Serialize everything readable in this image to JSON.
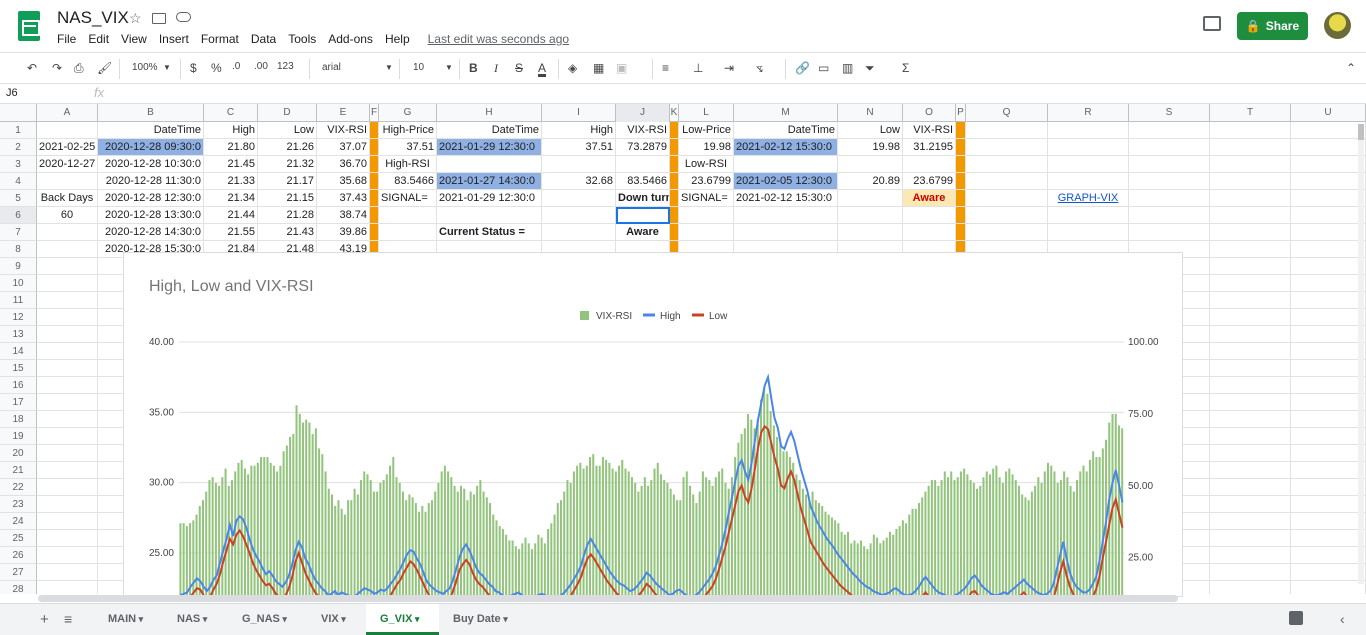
{
  "doc": {
    "title": "NAS_VIX",
    "last_edit": "Last edit was seconds ago",
    "share_label": "Share"
  },
  "menu": [
    "File",
    "Edit",
    "View",
    "Insert",
    "Format",
    "Data",
    "Tools",
    "Add-ons",
    "Help"
  ],
  "toolbar": {
    "zoom": "100%",
    "currency": "$",
    "percent": "%",
    "dec_less": ".0",
    "dec_more": ".00",
    "format_more": "123",
    "font": "arial",
    "font_size": "10",
    "bold": "B",
    "italic": "I",
    "strike": "S",
    "text_color": "A",
    "sigma": "Σ"
  },
  "formula": {
    "name_box": "J6",
    "fx": "fx",
    "value": ""
  },
  "columns": [
    "A",
    "B",
    "C",
    "D",
    "E",
    "F",
    "G",
    "H",
    "I",
    "J",
    "K",
    "L",
    "M",
    "N",
    "O",
    "P",
    "Q",
    "R",
    "S",
    "T",
    "U"
  ],
  "rows": [
    "1",
    "2",
    "3",
    "4",
    "5",
    "6",
    "7",
    "8",
    "9",
    "10",
    "11",
    "12",
    "13",
    "14",
    "15",
    "16",
    "17",
    "18",
    "19",
    "20",
    "21",
    "22",
    "23",
    "24",
    "25",
    "26",
    "27",
    "28"
  ],
  "cells": {
    "B1": "DateTime",
    "C1": "High",
    "D1": "Low",
    "E1": "VIX-RSI",
    "G1": "High-Price",
    "H1": "DateTime",
    "I1": "High",
    "J1": "VIX-RSI",
    "L1": "Low-Price",
    "M1": "DateTime",
    "N1": "Low",
    "O1": "VIX-RSI",
    "A2": "2021-02-25",
    "B2": "2020-12-28 09:30:0",
    "C2": "21.80",
    "D2": "21.26",
    "E2": "37.07",
    "G2": "37.51",
    "H2": "2021-01-29 12:30:0",
    "I2": "37.51",
    "J2": "73.2879",
    "L2": "19.98",
    "M2": "2021-02-12 15:30:0",
    "N2": "19.98",
    "O2": "31.2195",
    "A3": "2020-12-27",
    "B3": "2020-12-28 10:30:0",
    "C3": "21.45",
    "D3": "21.32",
    "E3": "36.70",
    "G3": "High-RSI",
    "L3": "Low-RSI",
    "B4": "2020-12-28 11:30:0",
    "C4": "21.33",
    "D4": "21.17",
    "E4": "35.68",
    "G4": "83.5466",
    "H4": "2021-01-27 14:30:0",
    "I4": "32.68",
    "J4": "83.5466",
    "L4": "23.6799",
    "M4": "2021-02-05 12:30:0",
    "N4": "20.89",
    "O4": "23.6799",
    "A5": "Back Days",
    "B5": "2020-12-28 12:30:0",
    "C5": "21.34",
    "D5": "21.15",
    "E5": "37.43",
    "G5": "SIGNAL=",
    "H5": "2021-01-29 12:30:0",
    "J5": "Down turn",
    "L5": "SIGNAL=",
    "M5": "2021-02-12 15:30:0",
    "O5": "Aware",
    "R5": "GRAPH-VIX",
    "A6": "60",
    "B6": "2020-12-28 13:30:0",
    "C6": "21.44",
    "D6": "21.28",
    "E6": "38.74",
    "B7": "2020-12-28 14:30:0",
    "C7": "21.55",
    "D7": "21.43",
    "E7": "39.86",
    "H7": "Current Status =",
    "J7": "Aware",
    "B8": "2020-12-28 15:30:0",
    "C8": "21.84",
    "D8": "21.48",
    "E8": "43.19",
    "B9": "202",
    "B10": "202",
    "B11": "202",
    "B12": "202",
    "B13": "202",
    "B14": "202",
    "B15": "202",
    "B16": "202",
    "B17": "202",
    "B18": "202",
    "B19": "202",
    "B20": "202",
    "B21": "202",
    "B22": "202",
    "B23": "202",
    "B24": "202",
    "B25": "202",
    "B26": "202",
    "B27": "202",
    "B28": "202"
  },
  "tabs": [
    "MAIN",
    "NAS",
    "G_NAS",
    "VIX",
    "G_VIX",
    "Buy Date"
  ],
  "active_tab": "G_VIX",
  "chart_data": {
    "type": "bar+line",
    "title": "High, Low and VIX-RSI",
    "legend": [
      "VIX-RSI",
      "High",
      "Low"
    ],
    "legend_position": "top",
    "colors": {
      "VIX-RSI": "#93c47d",
      "High": "#4a86e8",
      "Low": "#cc4125"
    },
    "y_left_ticks": [
      "40.00",
      "35.00",
      "30.00",
      "25.00"
    ],
    "y_right_ticks": [
      "100.00",
      "75.00",
      "50.00",
      "25.00"
    ],
    "y_left_range": [
      21.8,
      40
    ],
    "y_right_range": [
      11,
      100
    ],
    "vix_rsi": [
      37,
      37,
      36,
      37,
      38,
      40,
      43,
      45,
      48,
      52,
      53,
      51,
      50,
      53,
      56,
      50,
      52,
      55,
      58,
      59,
      56,
      54,
      57,
      57,
      58,
      60,
      60,
      60,
      58,
      57,
      55,
      57,
      62,
      64,
      67,
      68,
      78,
      75,
      72,
      73,
      72,
      68,
      70,
      63,
      61,
      55,
      49,
      47,
      43,
      45,
      42,
      40,
      45,
      45,
      49,
      47,
      52,
      55,
      54,
      52,
      48,
      48,
      51,
      52,
      54,
      57,
      60,
      53,
      51,
      48,
      45,
      47,
      46,
      44,
      41,
      43,
      41,
      44,
      45,
      48,
      51,
      55,
      57,
      55,
      53,
      50,
      48,
      50,
      49,
      45,
      48,
      47,
      50,
      52,
      48,
      46,
      44,
      40,
      38,
      36,
      35,
      33,
      31,
      31,
      29,
      28,
      30,
      32,
      30,
      28,
      30,
      33,
      32,
      30,
      35,
      37,
      40,
      44,
      45,
      48,
      52,
      51,
      55,
      57,
      58,
      56,
      57,
      60,
      61,
      57,
      57,
      60,
      59,
      58,
      56,
      55,
      57,
      59,
      56,
      55,
      53,
      51,
      48,
      50,
      53,
      50,
      52,
      56,
      58,
      54,
      52,
      51,
      49,
      47,
      45,
      45,
      53,
      55,
      50,
      47,
      44,
      48,
      55,
      53,
      52,
      50,
      53,
      55,
      56,
      51,
      49,
      53,
      60,
      65,
      68,
      70,
      75,
      73,
      70,
      73,
      80,
      84,
      82,
      76,
      71,
      67,
      65,
      62,
      62,
      60,
      58,
      54,
      52,
      49,
      47,
      45,
      48,
      45,
      44,
      43,
      41,
      40,
      39,
      38,
      37,
      34,
      33,
      34,
      30,
      31,
      30,
      31,
      29,
      28,
      30,
      33,
      32,
      30,
      31,
      32,
      34,
      33,
      35,
      36,
      38,
      37,
      40,
      42,
      42,
      44,
      46,
      48,
      50,
      52,
      52,
      50,
      52,
      55,
      53,
      55,
      52,
      53,
      55,
      56,
      54,
      52,
      51,
      49,
      50,
      53,
      55,
      54,
      56,
      57,
      53,
      51,
      55,
      56,
      54,
      52,
      50,
      47,
      46,
      45,
      48,
      50,
      53,
      51,
      55,
      58,
      57,
      55,
      51,
      52,
      55,
      53,
      50,
      48,
      52,
      55,
      57,
      55,
      59,
      62,
      60,
      60,
      63,
      66,
      72,
      75,
      75,
      71,
      70
    ],
    "high": [
      22.0,
      22.1,
      22.2,
      22.6,
      22.9,
      23.2,
      23.0,
      22.6,
      22.3,
      22.6,
      23.1,
      23.4,
      24.3,
      25.2,
      26.0,
      27.0,
      26.2,
      27.3,
      27.6,
      27.4,
      26.8,
      26.0,
      25.3,
      24.8,
      24.4,
      23.9,
      23.5,
      23.7,
      23.4,
      23.0,
      22.8,
      22.6,
      22.9,
      23.4,
      24.2,
      25.2,
      25.8,
      25.4,
      24.6,
      24.2,
      23.6,
      23.1,
      22.8,
      22.5,
      22.3,
      22.0,
      22.1,
      22.3,
      22.0,
      22.2,
      22.1,
      22.0,
      21.9,
      21.9,
      22.1,
      22.3,
      22.5,
      22.4,
      22.3,
      22.1,
      22.2,
      22.4,
      22.3,
      22.5,
      22.8,
      23.1,
      23.5,
      23.9,
      24.4,
      24.9,
      25.2,
      25.1,
      24.6,
      24.2,
      23.6,
      23.0,
      22.7,
      22.5,
      22.3,
      22.2,
      22.1,
      22.3,
      22.5,
      23.1,
      23.9,
      24.7,
      25.3,
      25.6,
      25.2,
      24.6,
      24.0,
      23.6,
      23.4,
      23.1,
      22.8,
      22.6,
      22.3,
      22.2,
      22.0,
      21.9,
      21.9,
      22.0,
      22.1,
      22.2,
      22.0,
      21.9,
      21.8,
      21.8,
      21.9,
      22.0,
      22.1,
      22.0,
      21.9,
      21.8,
      21.8,
      21.9,
      22.0,
      22.2,
      22.5,
      22.8,
      23.2,
      23.6,
      24.1,
      24.9,
      25.6,
      26.0,
      25.6,
      25.2,
      24.8,
      24.4,
      24.0,
      23.6,
      23.3,
      23.0,
      22.8,
      22.7,
      22.5,
      22.3,
      22.4,
      22.6,
      22.9,
      23.2,
      23.6,
      23.4,
      23.1,
      22.8,
      22.6,
      22.4,
      22.2,
      22.0,
      22.1,
      22.3,
      22.4,
      22.2,
      22.0,
      21.9,
      21.9,
      22.0,
      22.2,
      22.5,
      22.8,
      23.1,
      23.5,
      24.0,
      24.8,
      25.6,
      26.6,
      27.8,
      28.9,
      30.1,
      31.2,
      31.6,
      30.8,
      30.2,
      31.4,
      33.0,
      34.5,
      35.7,
      36.9,
      37.5,
      36.0,
      34.6,
      33.9,
      32.6,
      32.4,
      33.1,
      33.6,
      33.0,
      32.0,
      31.0,
      30.2,
      29.4,
      28.3,
      27.8,
      27.2,
      26.8,
      26.4,
      26.0,
      25.7,
      25.4,
      25.0,
      24.7,
      24.4,
      24.1,
      23.8,
      23.5,
      23.3,
      23.0,
      22.8,
      22.6,
      22.5,
      22.3,
      22.2,
      22.1,
      22.0,
      22.1,
      22.2,
      22.4,
      22.5,
      22.3,
      22.1,
      22.0,
      22.0,
      22.1,
      22.3,
      22.6,
      23.0,
      23.3,
      23.0,
      22.7,
      22.4,
      22.2,
      22.1,
      22.0,
      21.9,
      21.9,
      22.0,
      22.1,
      22.3,
      22.5,
      22.8,
      23.2,
      23.4,
      23.1,
      22.7,
      22.5,
      22.3,
      22.1,
      22.0,
      22.0,
      22.1,
      22.2,
      22.1,
      22.3,
      22.5,
      22.7,
      22.9,
      23.1,
      22.8,
      22.6,
      22.4,
      22.2,
      22.1,
      22.0,
      22.1,
      22.3,
      22.8,
      23.8,
      24.8,
      25.8,
      24.6,
      23.6,
      23.0,
      22.6,
      22.4,
      22.2,
      22.2,
      22.4,
      22.8,
      23.3,
      24.4,
      25.8,
      27.2,
      28.8,
      30.0,
      30.9,
      29.8,
      28.6
    ],
    "low": [
      21.4,
      21.5,
      21.6,
      21.9,
      22.2,
      22.5,
      22.4,
      22.0,
      21.8,
      21.9,
      22.4,
      22.8,
      23.5,
      24.4,
      25.2,
      26.0,
      25.6,
      26.3,
      26.6,
      26.2,
      25.6,
      25.0,
      24.3,
      23.8,
      23.4,
      23.0,
      22.7,
      22.8,
      22.5,
      22.1,
      21.9,
      21.8,
      22.0,
      22.5,
      23.3,
      24.4,
      25.0,
      24.3,
      23.6,
      23.1,
      22.6,
      22.2,
      21.9,
      21.7,
      21.6,
      21.4,
      21.4,
      21.6,
      21.4,
      21.5,
      21.4,
      21.3,
      21.2,
      21.2,
      21.4,
      21.6,
      21.7,
      21.6,
      21.5,
      21.4,
      21.5,
      21.6,
      21.5,
      21.7,
      22.0,
      22.4,
      22.8,
      23.1,
      23.6,
      24.0,
      24.4,
      24.2,
      23.8,
      23.3,
      22.8,
      22.3,
      21.9,
      21.7,
      21.5,
      21.4,
      21.3,
      21.5,
      21.7,
      22.3,
      23.0,
      23.8,
      24.2,
      24.5,
      24.2,
      23.6,
      23.1,
      22.8,
      22.6,
      22.3,
      22.0,
      21.8,
      21.6,
      21.4,
      21.2,
      21.1,
      21.1,
      21.2,
      21.3,
      21.4,
      21.2,
      21.1,
      21.0,
      21.0,
      21.1,
      21.2,
      21.3,
      21.2,
      21.1,
      21.0,
      21.0,
      21.1,
      21.2,
      21.4,
      21.6,
      22.0,
      22.4,
      22.8,
      23.3,
      24.0,
      24.6,
      24.9,
      24.6,
      24.2,
      23.8,
      23.4,
      23.0,
      22.7,
      22.4,
      22.1,
      21.9,
      21.8,
      21.7,
      21.5,
      21.6,
      21.8,
      22.1,
      22.4,
      22.8,
      22.6,
      22.3,
      22.0,
      21.8,
      21.6,
      21.4,
      21.2,
      21.3,
      21.5,
      21.6,
      21.4,
      21.2,
      21.1,
      21.1,
      21.2,
      21.4,
      21.6,
      22.0,
      22.3,
      22.6,
      23.1,
      23.8,
      24.6,
      25.4,
      26.4,
      27.4,
      28.4,
      29.4,
      29.8,
      29.0,
      28.6,
      29.6,
      31.0,
      32.5,
      33.6,
      34.0,
      33.8,
      32.8,
      31.8,
      31.0,
      29.8,
      29.6,
      30.3,
      30.8,
      30.2,
      29.2,
      28.2,
      27.4,
      26.6,
      25.8,
      25.4,
      25.0,
      24.6,
      24.2,
      23.9,
      23.6,
      23.3,
      23.0,
      22.7,
      22.5,
      22.3,
      22.1,
      21.9,
      21.8,
      21.6,
      21.5,
      21.4,
      21.3,
      21.2,
      21.2,
      21.1,
      21.0,
      21.1,
      21.2,
      21.3,
      21.4,
      21.3,
      21.1,
      21.0,
      21.0,
      21.1,
      21.3,
      21.6,
      21.9,
      22.2,
      21.9,
      21.6,
      21.4,
      21.2,
      21.1,
      21.0,
      20.9,
      20.9,
      21.0,
      21.1,
      21.3,
      21.5,
      21.8,
      22.2,
      22.3,
      22.0,
      21.7,
      21.5,
      21.3,
      21.2,
      21.1,
      21.1,
      21.2,
      21.3,
      21.2,
      21.4,
      21.6,
      21.8,
      22.0,
      22.2,
      21.9,
      21.7,
      21.5,
      21.3,
      21.2,
      21.1,
      21.2,
      21.4,
      21.8,
      22.6,
      23.6,
      24.4,
      23.4,
      22.6,
      22.1,
      21.7,
      21.5,
      21.3,
      21.3,
      21.5,
      21.9,
      22.4,
      23.3,
      24.6,
      25.8,
      27.0,
      28.2,
      28.8,
      27.8,
      26.8
    ]
  }
}
